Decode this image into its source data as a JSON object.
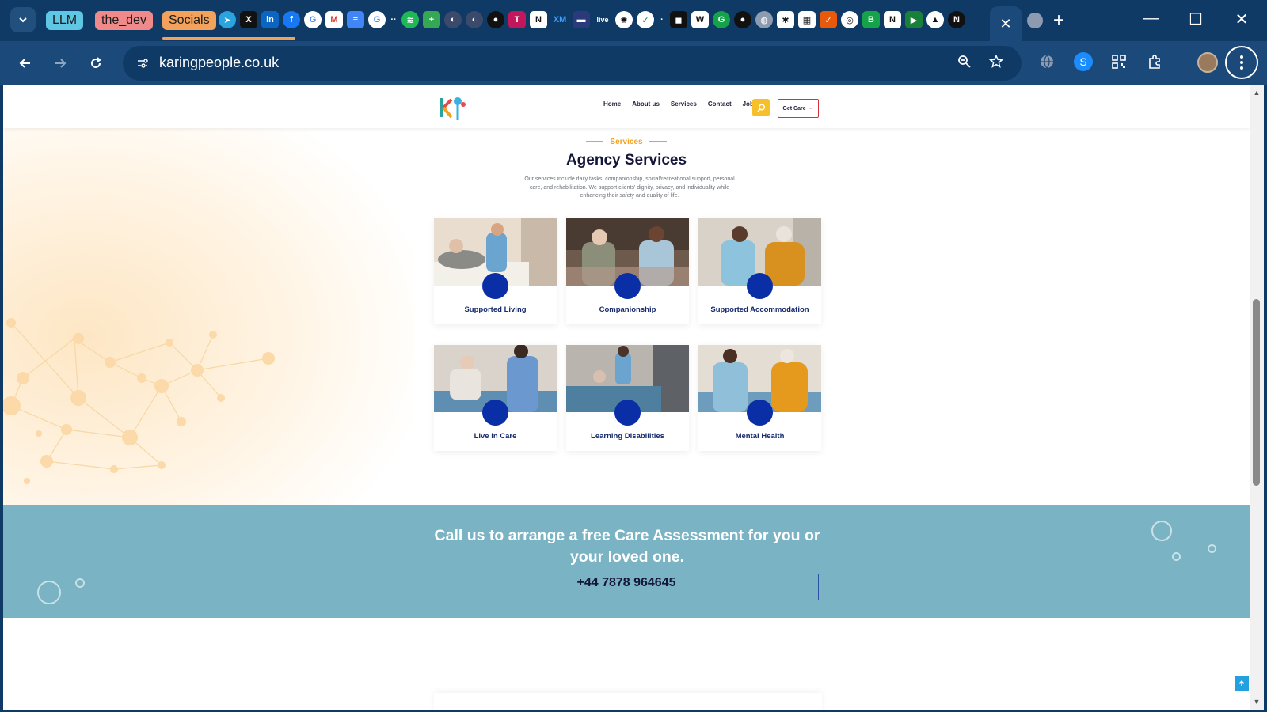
{
  "browser": {
    "tab_groups": [
      {
        "label": "LLM",
        "color": "#5fc6e3"
      },
      {
        "label": "the_dev",
        "color": "#f08a8a"
      },
      {
        "label": "Socials",
        "color": "#f2a25a"
      }
    ],
    "active_tab_close": "✕",
    "new_tab": "+",
    "window": {
      "minimize": "—",
      "maximize": "☐",
      "close": "✕"
    },
    "url": "karingpeople.co.uk"
  },
  "site": {
    "nav": [
      "Home",
      "About us",
      "Services",
      "Contact",
      "Jobs"
    ],
    "get_care": "Get Care",
    "get_care_arrow": "→",
    "eyebrow": "Services",
    "title": "Agency Services",
    "description": "Our services include daily tasks, companionship, social/recreational support, personal care, and rehabilitation. We support clients' dignity, privacy, and individuality while enhancing their safety and quality of life.",
    "services": [
      {
        "label": "Supported Living"
      },
      {
        "label": "Companionship"
      },
      {
        "label": "Supported Accommodation"
      },
      {
        "label": "Live in Care"
      },
      {
        "label": "Learning Disabilities"
      },
      {
        "label": "Mental Health"
      }
    ],
    "cta_title": "Call us to arrange a free Care Assessment for you or your loved one.",
    "cta_phone": "+44 7878 964645",
    "accent": "#0a2ea6",
    "cta_bg": "#79b3c4"
  }
}
